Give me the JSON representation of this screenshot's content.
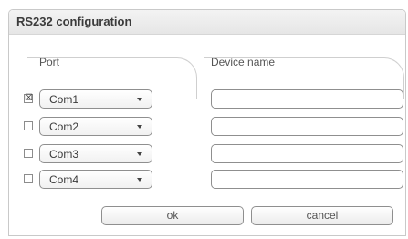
{
  "dialog": {
    "title": "RS232 configuration",
    "columns": {
      "port": "Port",
      "device_name": "Device name"
    },
    "rows": [
      {
        "checked": "☒",
        "port": "Com1",
        "device_name": ""
      },
      {
        "checked": "",
        "port": "Com2",
        "device_name": ""
      },
      {
        "checked": "",
        "port": "Com3",
        "device_name": ""
      },
      {
        "checked": "",
        "port": "Com4",
        "device_name": ""
      }
    ],
    "buttons": {
      "ok": "ok",
      "cancel": "cancel"
    }
  }
}
